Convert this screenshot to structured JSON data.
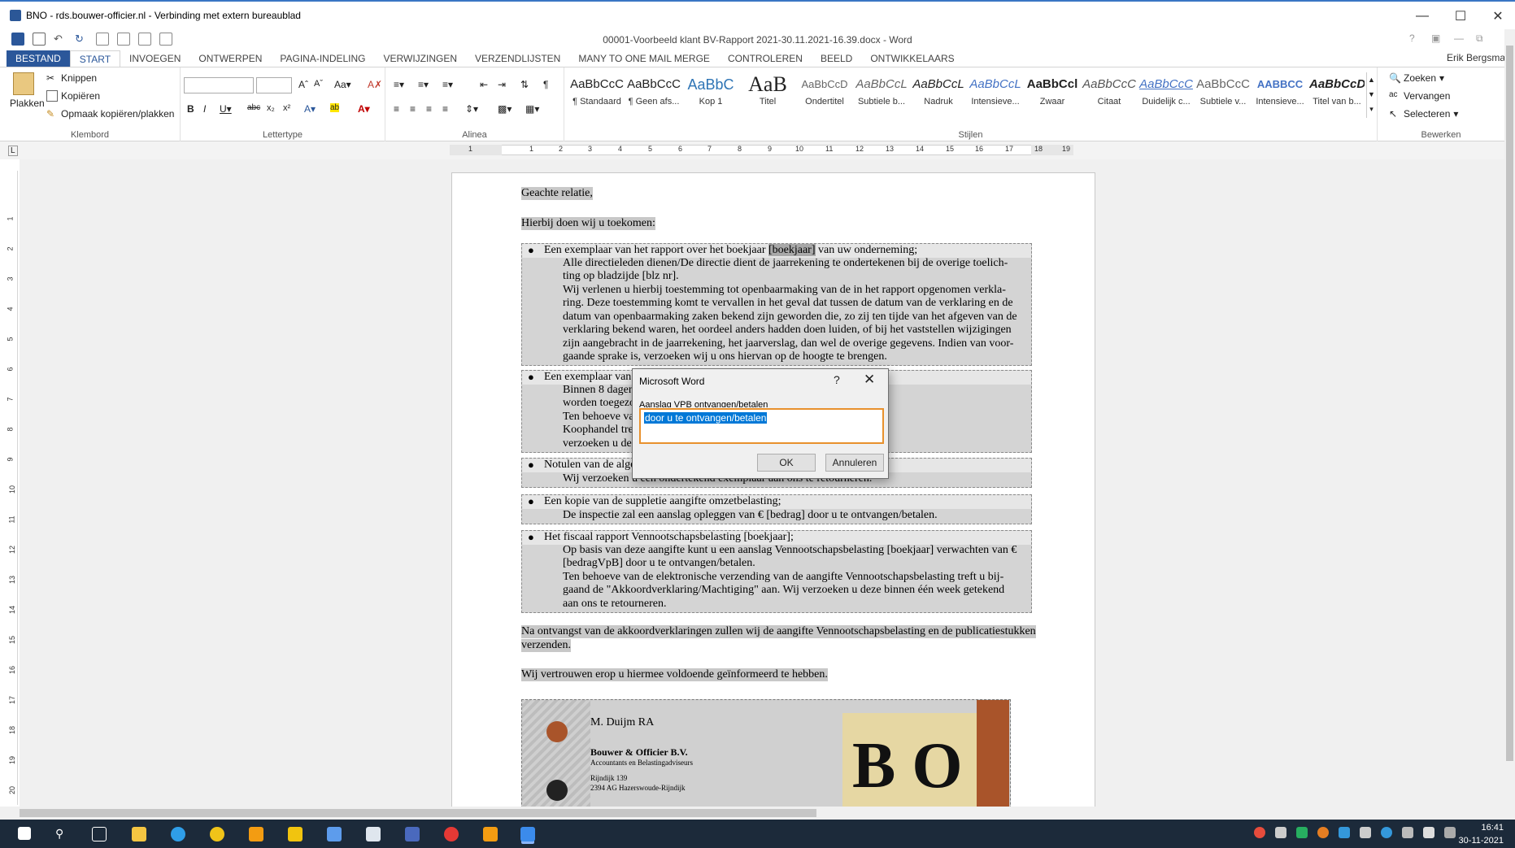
{
  "rdp": {
    "title": "BNO - rds.bouwer-officier.nl - Verbinding met extern bureaublad"
  },
  "word": {
    "doc_title": "00001-Voorbeeld klant BV-Rapport 2021-30.11.2021-16.39.docx - Word",
    "user": "Erik Bergsma"
  },
  "tabs": [
    "BESTAND",
    "START",
    "INVOEGEN",
    "ONTWERPEN",
    "PAGINA-INDELING",
    "VERWIJZINGEN",
    "VERZENDLIJSTEN",
    "MANY TO ONE MAIL MERGE",
    "CONTROLEREN",
    "BEELD",
    "ONTWIKKELAARS"
  ],
  "ribbon": {
    "clipboard": {
      "paste": "Plakken",
      "cut": "Knippen",
      "copy": "Kopiëren",
      "format_painter": "Opmaak kopiëren/plakken",
      "label": "Klembord"
    },
    "font": {
      "label": "Lettertype"
    },
    "paragraph": {
      "label": "Alinea"
    },
    "styles": {
      "label": "Stijlen",
      "items": [
        {
          "sample": "AaBbCcC",
          "name": "¶ Standaard"
        },
        {
          "sample": "AaBbCcC",
          "name": "¶ Geen afs..."
        },
        {
          "sample": "AaBbC",
          "name": "Kop 1"
        },
        {
          "sample": "AaB",
          "name": "Titel"
        },
        {
          "sample": "AaBbCcD",
          "name": "Ondertitel"
        },
        {
          "sample": "AaBbCcL",
          "name": "Subtiele b..."
        },
        {
          "sample": "AaBbCcL",
          "name": "Nadruk"
        },
        {
          "sample": "AaBbCcL",
          "name": "Intensieve..."
        },
        {
          "sample": "AaBbCcl",
          "name": "Zwaar"
        },
        {
          "sample": "AaBbCcC",
          "name": "Citaat"
        },
        {
          "sample": "AaBbCcC",
          "name": "Duidelijk c..."
        },
        {
          "sample": "AaBbCcC",
          "name": "Subtiele v..."
        },
        {
          "sample": "AABBCC",
          "name": "Intensieve..."
        },
        {
          "sample": "AaBbCcD",
          "name": "Titel van b..."
        }
      ]
    },
    "editing": {
      "find": "Zoeken",
      "replace": "Vervangen",
      "select": "Selecteren",
      "label": "Bewerken"
    }
  },
  "ruler": [
    "1",
    "1",
    "2",
    "3",
    "4",
    "5",
    "6",
    "7",
    "8",
    "9",
    "10",
    "11",
    "12",
    "13",
    "14",
    "15",
    "16",
    "17",
    "18",
    "19"
  ],
  "vruler": [
    "1",
    "2",
    "3",
    "4",
    "5",
    "6",
    "7",
    "8",
    "9",
    "10",
    "11",
    "12",
    "13",
    "14",
    "15",
    "16",
    "17",
    "18",
    "19",
    "20"
  ],
  "document": {
    "greeting": "Geachte relatie,",
    "intro": "Hierbij doen wij u toekomen:",
    "b1": "Een exemplaar van het rapport over het boekjaar",
    "b1_field": "[boekjaar]",
    "b1_end": "van uw onderneming;",
    "b1_sub": [
      "Alle directieleden dienen/De directie dient de jaarrekening te ondertekenen bij de overige toelich-",
      "ting op bladzijde [blz nr].",
      "Wij verlenen u hierbij toestemming tot openbaarmaking van de in het rapport opgenomen verkla-",
      "ring. Deze toestemming komt te vervallen in het geval dat tussen de datum van de verklaring en de",
      "datum van openbaarmaking zaken bekend zijn geworden die, zo zij ten tijde van het afgeven van de",
      "verklaring bekend waren, het oordeel anders hadden doen luiden, of bij het vaststellen wijzigingen",
      "zijn aangebracht in de jaarrekening, het jaarverslag, dan wel de overige gegevens. Indien van voor-",
      "gaande sprake is, verzoeken wij u ons hiervan op de hoogte te brengen."
    ],
    "b2": "Een exemplaar van de t",
    "b2_sub": [
      "Binnen 8 dagen na d                                                    ning elektronisch te",
      "worden toegezonde",
      "Ten behoeve van de                                                        g naar de Kamer van",
      "Koophandel treft u h                                                       g [boekjaar]\" aan. Wij",
      "verzoeken u deze bi"
    ],
    "b3": "Notulen van de algemen",
    "b3_sub": "Wij verzoeken u een ondertekend exemplaar aan ons te retourneren.",
    "b4": "Een kopie van de suppletie aangifte omzetbelasting;",
    "b4_sub": "De inspectie zal een aanslag opleggen van € [bedrag] door u te ontvangen/betalen.",
    "b5": "Het fiscaal rapport Vennootschapsbelasting [boekjaar];",
    "b5_sub": [
      "Op basis van deze aangifte kunt u een aanslag Vennootschapsbelasting [boekjaar] verwachten van €",
      "[bedragVpB] door u te ontvangen/betalen.",
      "Ten behoeve van de elektronische verzending van de aangifte Vennootschapsbelasting treft u bij-",
      "gaand de \"Akkoordverklaring/Machtiging\" aan. Wij verzoeken u deze binnen één week getekend",
      "aan ons te retourneren."
    ],
    "closing1": "Na ontvangst van de akkoordverklaringen zullen wij de aangifte Vennootschapsbelasting en de publicatiestukken",
    "closing1b": "verzenden.",
    "closing2": "Wij vertrouwen erop u hiermee voldoende geïnformeerd te hebben.",
    "sig_name": "M. Duijm RA",
    "sig_company": "Bouwer & Officier B.V.",
    "sig_sub": "Accountants en Belastingadviseurs",
    "sig_addr1": "Rijndijk 139",
    "sig_addr2": "2394 AG  Hazerswoude-Rijndijk",
    "logo": "B O"
  },
  "dialog": {
    "title": "Microsoft Word",
    "help": "?",
    "label": "Aanslag VPB ontvangen/betalen",
    "value": "door u te ontvangen/betalen",
    "ok": "OK",
    "cancel": "Annuleren"
  },
  "taskbar": {
    "time": "16:41",
    "date": "30-11-2021"
  }
}
